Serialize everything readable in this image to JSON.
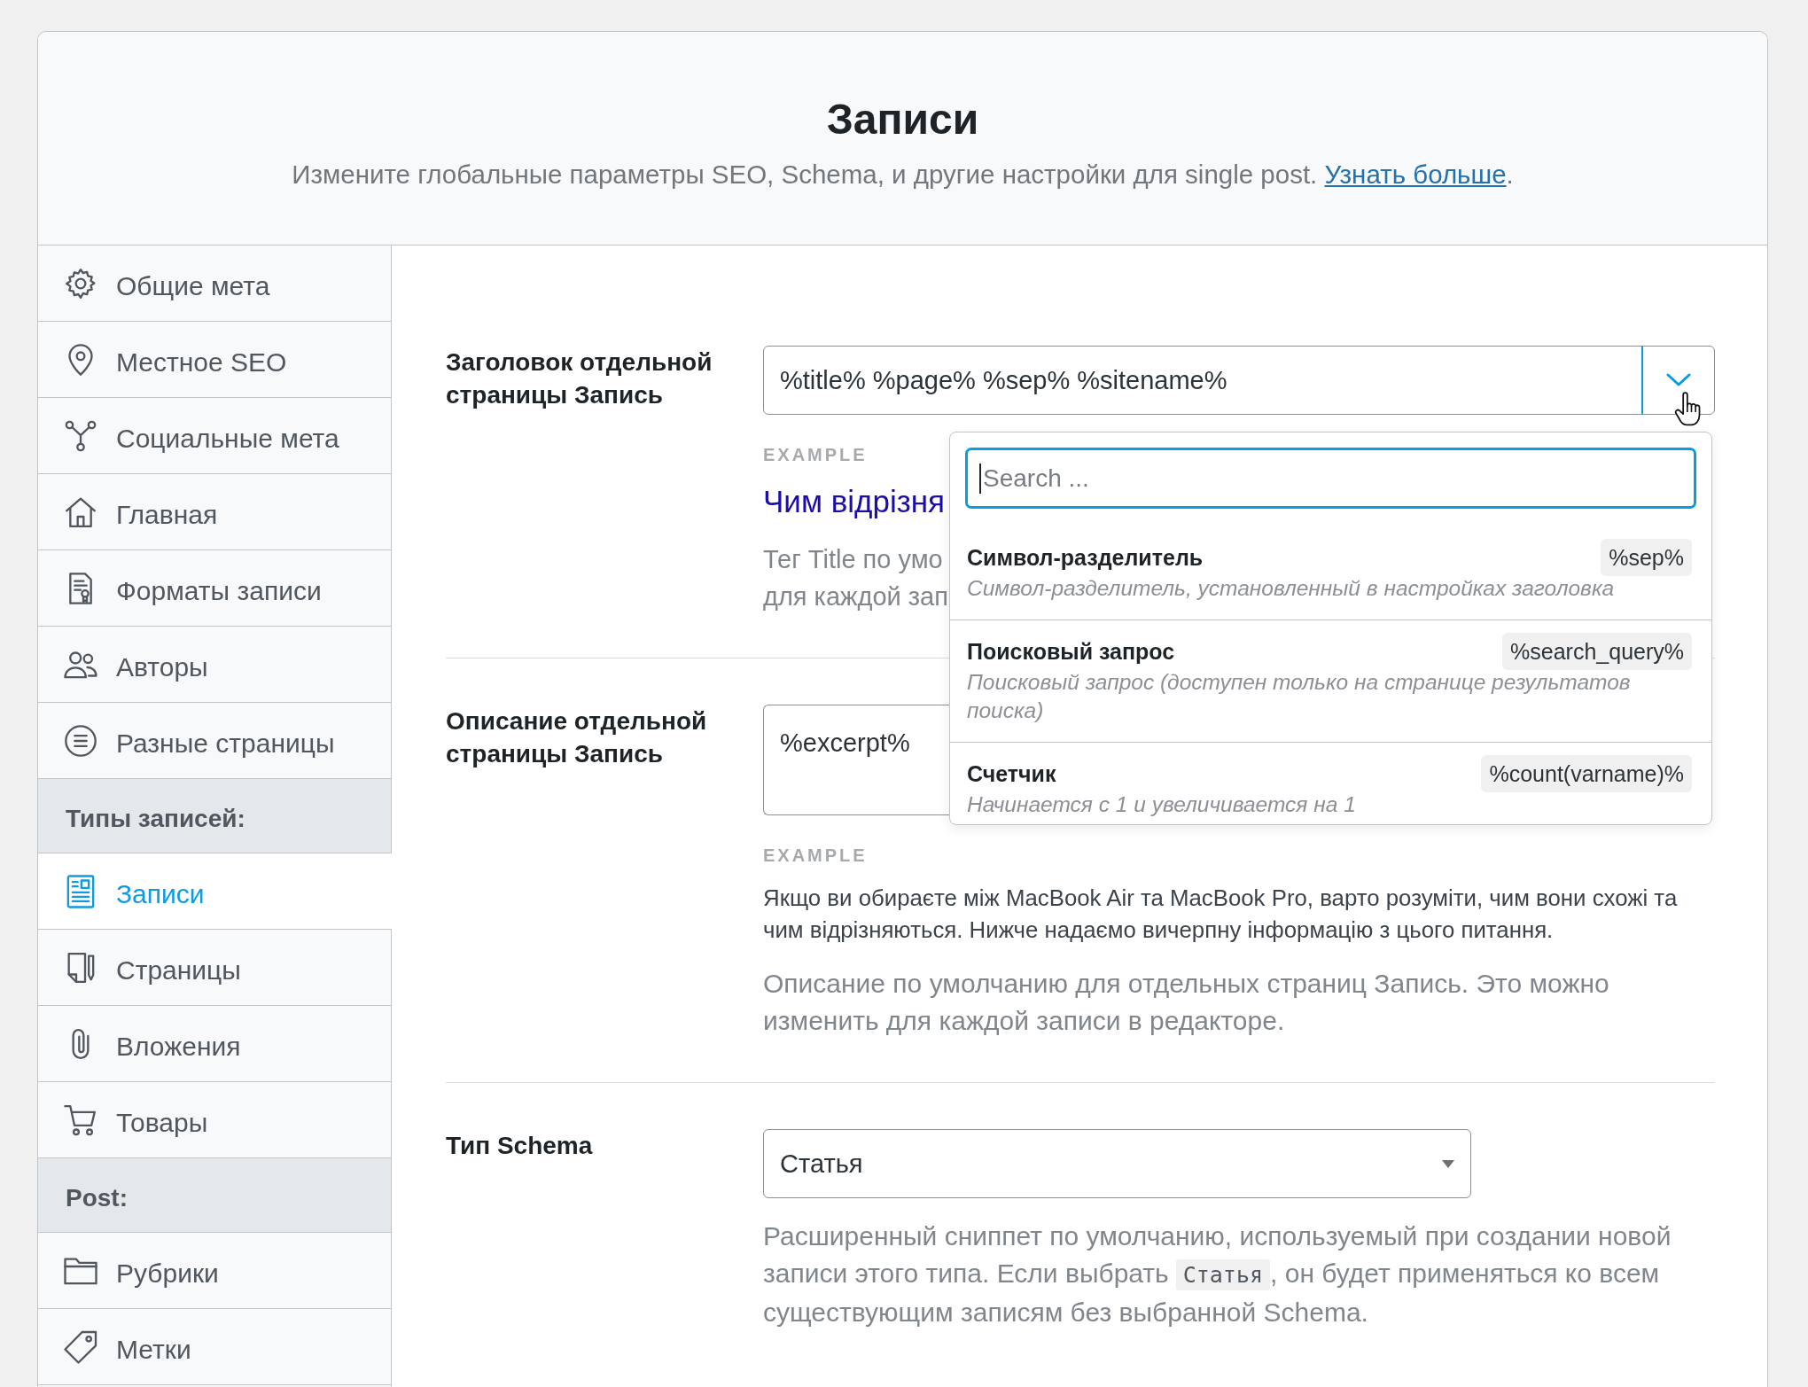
{
  "header": {
    "title": "Записи",
    "description": "Измените глобальные параметры SEO, Schema, и другие настройки для single post.",
    "link": "Узнать больше",
    "after_link": "."
  },
  "sidebar": {
    "groups": [
      {
        "items": [
          {
            "label": "Общие мета",
            "selected": false
          },
          {
            "label": "Местное SEO",
            "selected": false
          },
          {
            "label": "Социальные мета",
            "selected": false
          },
          {
            "label": "Главная",
            "selected": false
          },
          {
            "label": "Форматы записи",
            "selected": false
          },
          {
            "label": "Авторы",
            "selected": false
          },
          {
            "label": "Разные страницы",
            "selected": false
          }
        ]
      },
      {
        "heading": "Типы записей:",
        "items": [
          {
            "label": "Записи",
            "selected": true
          },
          {
            "label": "Страницы",
            "selected": false
          },
          {
            "label": "Вложения",
            "selected": false
          },
          {
            "label": "Товары",
            "selected": false
          }
        ]
      },
      {
        "heading": "Post:",
        "items": [
          {
            "label": "Рубрики",
            "selected": false
          },
          {
            "label": "Метки",
            "selected": false
          }
        ]
      }
    ]
  },
  "settings": [
    {
      "kind": "variable_field",
      "label": "Заголовок отдельной страницы Запись",
      "value": "%title% %page% %sep% %sitename%",
      "example_label": "EXAMPLE",
      "example_title": "Чим відрізня",
      "help_lines": [
        "Тег Title по умо",
        "для каждой зап"
      ],
      "variables": {
        "expanded": true,
        "search_placeholder": "Search ...",
        "items": [
          {
            "name": "Символ-разделитель",
            "tag": "%sep%",
            "description": "Символ-разделитель, установленный в настройках заголовка"
          },
          {
            "name": "Поисковый запрос",
            "tag": "%search_query%",
            "description": "Поисковый запрос (доступен только на странице результатов поиска)"
          },
          {
            "name": "Счетчик",
            "tag": "%count(varname)%",
            "description": "Начинается с 1 и увеличивается на 1"
          }
        ]
      }
    },
    {
      "kind": "textarea",
      "label": "Описание отдельной страницы Запись",
      "value": "%excerpt%",
      "example_label": "EXAMPLE",
      "example_text": "Якщо ви обираєте між MacBook Air та MacBook Pro, варто розуміти, чим вони схожі та чим відрізняються. Нижче надаємо вичерпну інформацію з цього питання.",
      "help": "Описание по умолчанию для отдельных страниц Запись. Это можно изменить для каждой записи в редакторе."
    },
    {
      "kind": "select",
      "label": "Тип Schema",
      "value": "Статья",
      "help_parts": [
        {
          "kind": "text",
          "text": "Расширенный сниппет по умолчанию, используемый при создании новой записи этого типа. Если выбрать"
        },
        {
          "kind": "code",
          "text": "Статья"
        },
        {
          "kind": "text",
          "text": ", он будет применяться ко всем существующим записям без выбранной Schema."
        }
      ]
    }
  ]
}
